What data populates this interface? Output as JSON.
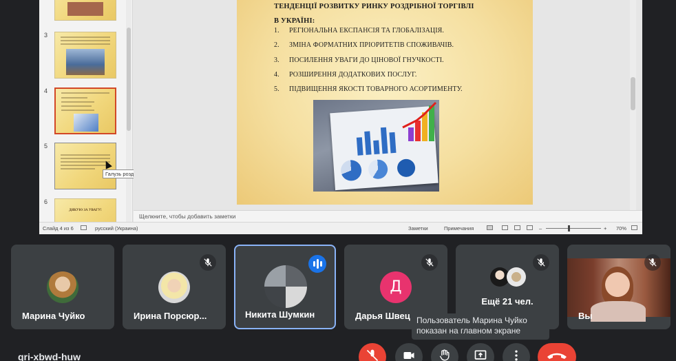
{
  "presentation": {
    "thumbnails": [
      {
        "number": "",
        "state": "normal"
      },
      {
        "number": "3",
        "state": "normal"
      },
      {
        "number": "4",
        "state": "active"
      },
      {
        "number": "5",
        "state": "hover"
      },
      {
        "number": "6",
        "state": "normal",
        "text": "ДЯКУЮ ЗА УВАГУ!"
      }
    ],
    "tooltip": "Галузь роздрібної торгівлі в У...",
    "slide": {
      "title_line1": "ТЕНДЕНЦІЇ РОЗВИТКУ РИНКУ РОЗДРІБНОЇ ТОРГІВЛІ",
      "title_line2": "В УКРАЇНІ:",
      "items": [
        {
          "num": "1.",
          "text": "РЕГІОНАЛЬНА ЕКСПАНСІЯ ТА ГЛОБАЛІЗАЦІЯ."
        },
        {
          "num": "2.",
          "text": "ЗМІНА ФОРМАТНИХ ПРІОРИТЕТІВ СПОЖИВАЧІВ."
        },
        {
          "num": "3.",
          "text": "ПОСИЛЕННЯ УВАГИ ДО ЦІНОВОЇ ГНУЧКОСТІ."
        },
        {
          "num": "4.",
          "text": "РОЗШИРЕННЯ ДОДАТКОВИХ ПОСЛУГ."
        },
        {
          "num": "5.",
          "text": "ПІДВИЩЕННЯ ЯКОСТІ ТОВАРНОГО АСОРТИМЕНТУ."
        }
      ]
    },
    "notes_placeholder": "Щелкните, чтобы добавить заметки",
    "status": {
      "slide_counter": "Слайд 4 из 6",
      "language": "русский (Украина)",
      "notes_btn": "Заметки",
      "comments_btn": "Примечания",
      "zoom": "70%"
    }
  },
  "participants": [
    {
      "name": "Марина Чуйко",
      "muted": false,
      "speaking": false
    },
    {
      "name": "Ирина Порсюр...",
      "muted": true,
      "speaking": false
    },
    {
      "name": "Никита Шумкин",
      "muted": false,
      "speaking": true
    },
    {
      "name": "Дарья Швец",
      "muted": true,
      "speaking": false,
      "initial": "Д",
      "avatar_color": "#e8336e"
    },
    {
      "name": "",
      "muted": true,
      "speaking": false,
      "more_label": "Ещё 21 чел."
    },
    {
      "name": "Вы",
      "muted": true,
      "speaking": false
    }
  ],
  "toast": {
    "line1": "Пользователь Марина Чуйко",
    "line2": "показан на главном экране"
  },
  "meeting_code": "qri-xbwd-huw",
  "controls": [
    "mic-off",
    "camera",
    "raise-hand",
    "present",
    "more-options",
    "leave-call"
  ],
  "colors": {
    "accent": "#1a73e8",
    "danger": "#ea4335",
    "tile_bg": "#3c4043",
    "bg": "#202124"
  }
}
